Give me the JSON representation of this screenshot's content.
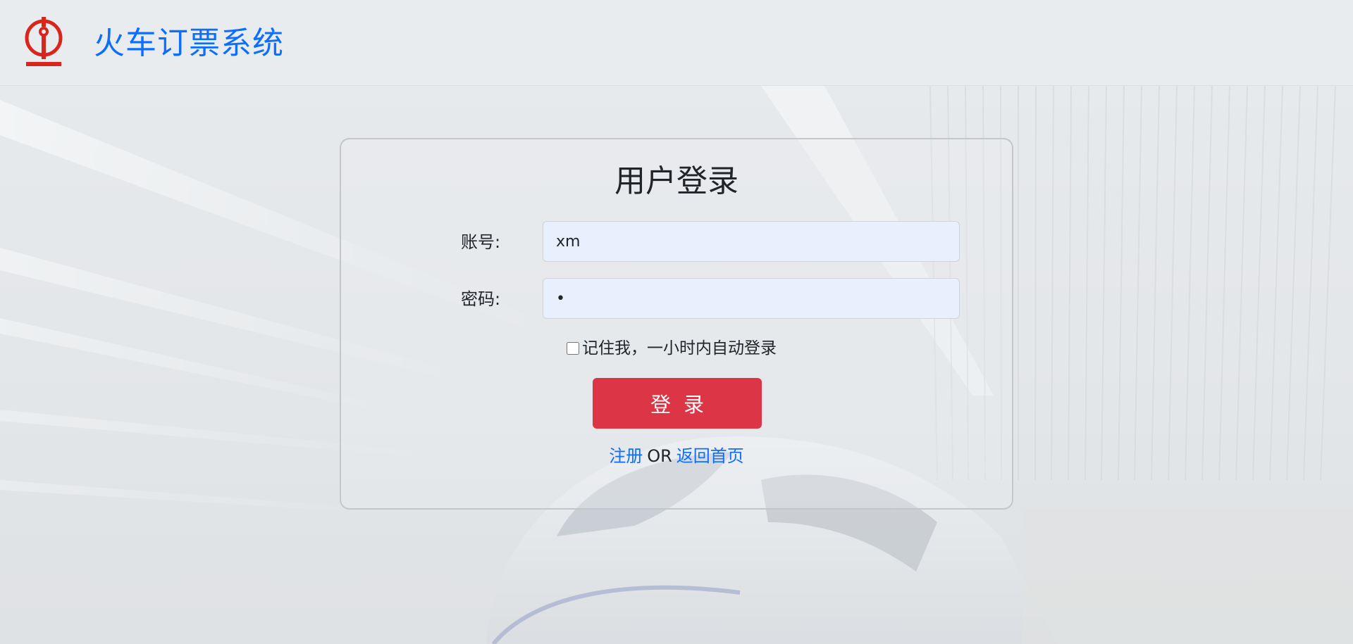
{
  "header": {
    "logo_icon": "railway-logo-icon",
    "brand_title": "火车订票系统",
    "brand_color": "#0d6efd",
    "logo_color": "#d9261c"
  },
  "login": {
    "title": "用户登录",
    "account_label": "账号:",
    "account_value": "xm",
    "password_label": "密码:",
    "password_value": "1",
    "remember_label": "记住我，一小时内自动登录",
    "remember_checked": false,
    "submit_label": "登录",
    "submit_color": "#dc3545",
    "register_link": "注册",
    "or_text": "OR",
    "home_link": "返回首页"
  }
}
